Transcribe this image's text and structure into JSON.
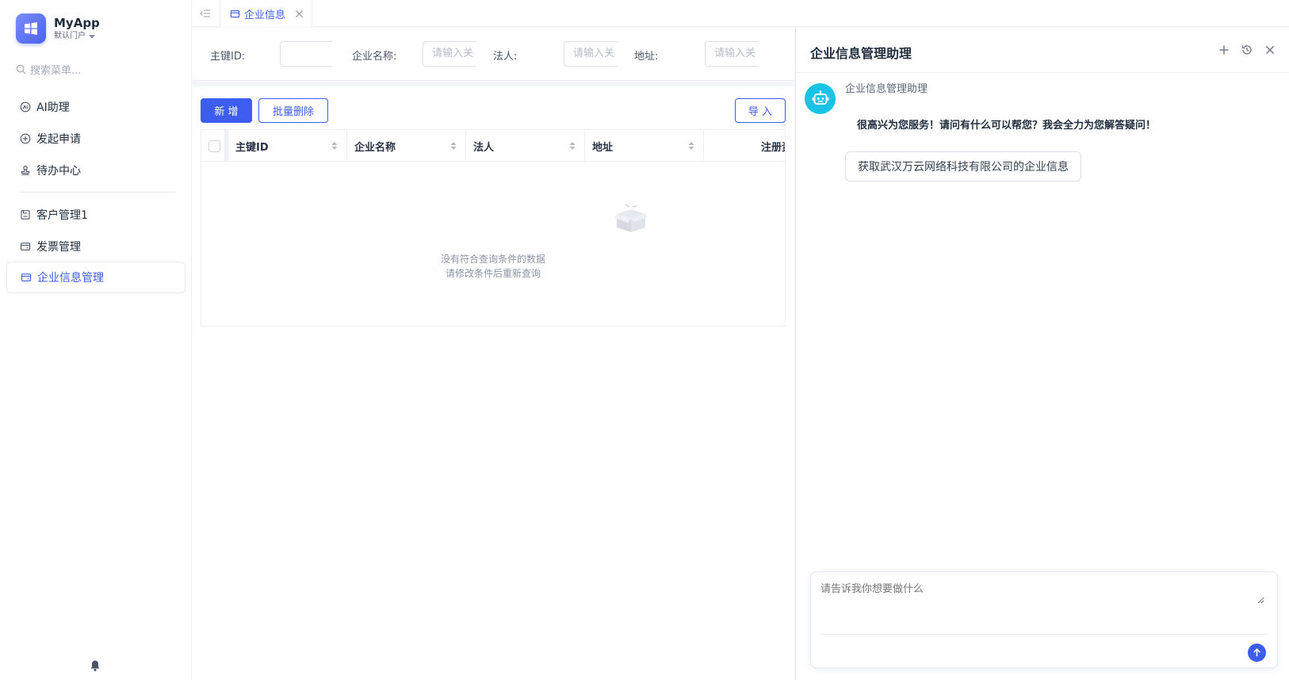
{
  "brand": {
    "name": "MyApp",
    "portal": "默认门户"
  },
  "sidebar": {
    "search_placeholder": "搜索菜单...",
    "items": [
      {
        "label": "AI助理",
        "icon": "ai-icon"
      },
      {
        "label": "发起申请",
        "icon": "plus-circle-icon"
      },
      {
        "label": "待办中心",
        "icon": "stamp-icon"
      },
      {
        "label": "客户管理1",
        "icon": "save-icon"
      },
      {
        "label": "发票管理",
        "icon": "card-icon"
      },
      {
        "label": "企业信息管理",
        "icon": "card-icon",
        "active": true
      }
    ]
  },
  "tabs": [
    {
      "label": "企业信息",
      "active": true
    }
  ],
  "filters": [
    {
      "label": "主键ID:",
      "placeholder": ""
    },
    {
      "label": "企业名称:",
      "placeholder": "请输入关"
    },
    {
      "label": "法人:",
      "placeholder": "请输入关"
    },
    {
      "label": "地址:",
      "placeholder": "请输入关"
    }
  ],
  "toolbar": {
    "add_label": "新 增",
    "batch_delete_label": "批量删除",
    "import_label": "导 入"
  },
  "table": {
    "columns": [
      "主键ID",
      "企业名称",
      "法人",
      "地址",
      "注册资"
    ],
    "empty_line1": "没有符合查询条件的数据",
    "empty_line2": "请修改条件后重新查询"
  },
  "assistant": {
    "title": "企业信息管理助理",
    "bot_name": "企业信息管理助理",
    "greeting": "很高兴为您服务！请问有什么可以帮您？我会全力为您解答疑问！",
    "suggestion": "获取武汉万云网络科技有限公司的企业信息",
    "input_placeholder": "请告诉我你想要做什么"
  },
  "colors": {
    "primary": "#3c5df0",
    "bot": "#18c3e6"
  }
}
